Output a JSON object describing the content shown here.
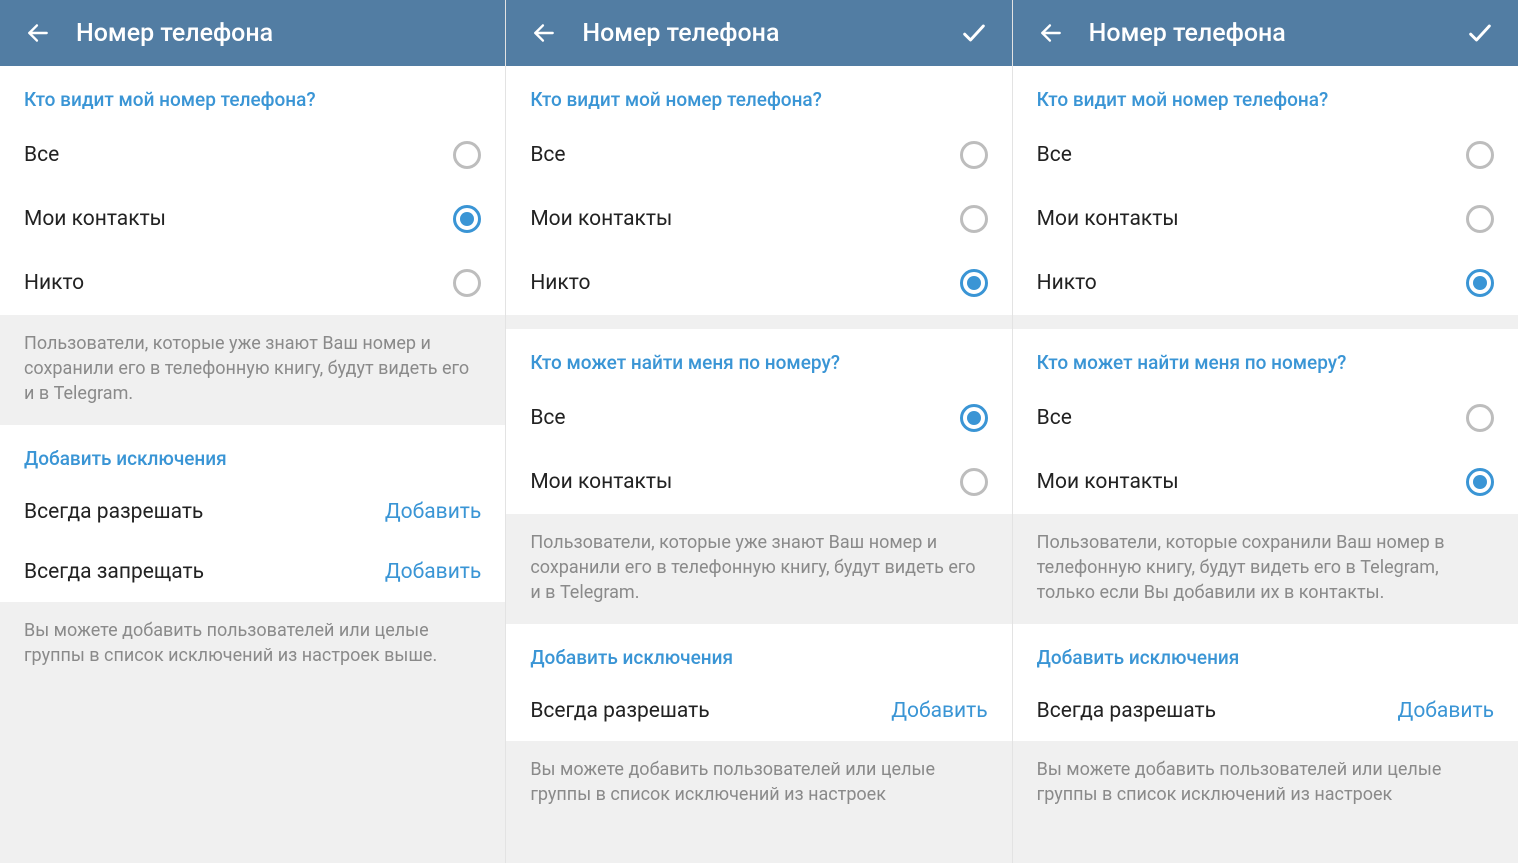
{
  "screens": [
    {
      "header": {
        "title": "Номер телефона",
        "show_confirm": false
      },
      "sections": [
        {
          "type": "radio",
          "title": "Кто видит мой номер телефона?",
          "options": [
            {
              "label": "Все",
              "selected": false
            },
            {
              "label": "Мои контакты",
              "selected": true
            },
            {
              "label": "Никто",
              "selected": false
            }
          ]
        },
        {
          "type": "hint",
          "text": "Пользователи, которые уже знают Ваш номер и сохранили его в телефонную книгу, будут видеть его и в Telegram."
        },
        {
          "type": "actions",
          "title": "Добавить исключения",
          "rows": [
            {
              "left": "Всегда разрешать",
              "right": "Добавить"
            },
            {
              "left": "Всегда запрещать",
              "right": "Добавить"
            }
          ]
        },
        {
          "type": "hint",
          "text": "Вы можете добавить пользователей или целые группы в список исключений из настроек выше."
        }
      ]
    },
    {
      "header": {
        "title": "Номер телефона",
        "show_confirm": true
      },
      "sections": [
        {
          "type": "radio",
          "title": "Кто видит мой номер телефона?",
          "options": [
            {
              "label": "Все",
              "selected": false
            },
            {
              "label": "Мои контакты",
              "selected": false
            },
            {
              "label": "Никто",
              "selected": true
            }
          ]
        },
        {
          "type": "radio",
          "title": "Кто может найти меня по номеру?",
          "pad_top": true,
          "options": [
            {
              "label": "Все",
              "selected": true
            },
            {
              "label": "Мои контакты",
              "selected": false
            }
          ]
        },
        {
          "type": "hint",
          "text": "Пользователи, которые уже знают Ваш номер и сохранили его в телефонную книгу, будут видеть его и в Telegram."
        },
        {
          "type": "actions",
          "title": "Добавить исключения",
          "rows": [
            {
              "left": "Всегда разрешать",
              "right": "Добавить"
            }
          ]
        },
        {
          "type": "hint",
          "text": "Вы можете добавить пользователей или целые группы в список исключений из настроек"
        }
      ]
    },
    {
      "header": {
        "title": "Номер телефона",
        "show_confirm": true
      },
      "sections": [
        {
          "type": "radio",
          "title": "Кто видит мой номер телефона?",
          "options": [
            {
              "label": "Все",
              "selected": false
            },
            {
              "label": "Мои контакты",
              "selected": false
            },
            {
              "label": "Никто",
              "selected": true
            }
          ]
        },
        {
          "type": "radio",
          "title": "Кто может найти меня по номеру?",
          "pad_top": true,
          "options": [
            {
              "label": "Все",
              "selected": false
            },
            {
              "label": "Мои контакты",
              "selected": true
            }
          ]
        },
        {
          "type": "hint",
          "text": "Пользователи, которые сохранили Ваш номер в телефонную книгу, будут видеть его в Telegram, только если Вы добавили их в контакты."
        },
        {
          "type": "actions",
          "title": "Добавить исключения",
          "rows": [
            {
              "left": "Всегда разрешать",
              "right": "Добавить"
            }
          ]
        },
        {
          "type": "hint",
          "text": "Вы можете добавить пользователей или целые группы в список исключений из настроек"
        }
      ]
    }
  ]
}
